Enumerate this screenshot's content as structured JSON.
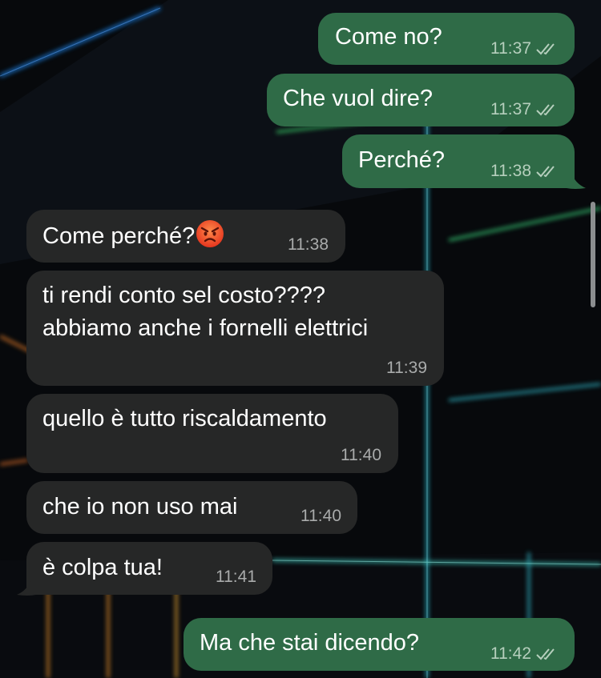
{
  "messages": [
    {
      "direction": "out",
      "text": "Come no?",
      "time": "11:37",
      "status_icon": "double-check-icon"
    },
    {
      "direction": "out",
      "text": "Che vuol dire?",
      "time": "11:37",
      "status_icon": "double-check-icon"
    },
    {
      "direction": "out",
      "text": "Perché?",
      "time": "11:38",
      "status_icon": "double-check-icon"
    },
    {
      "direction": "in",
      "text": "Come perché?",
      "emoji": "angry-face-emoji",
      "time": "11:38"
    },
    {
      "direction": "in",
      "lines": [
        "ti rendi conto sel costo????",
        "abbiamo anche i fornelli elettrici"
      ],
      "time": "11:39"
    },
    {
      "direction": "in",
      "text": "quello è tutto riscaldamento",
      "time": "11:40"
    },
    {
      "direction": "in",
      "text": "che io non uso mai",
      "time": "11:40"
    },
    {
      "direction": "in",
      "text": "è colpa tua!",
      "time": "11:41"
    },
    {
      "direction": "out",
      "text": "Ma che stai dicendo?",
      "time": "11:42",
      "status_icon": "double-check-icon"
    }
  ],
  "colors": {
    "outgoing_bubble": "#2f6b47",
    "incoming_bubble": "#262727",
    "text": "#ffffff",
    "outgoing_meta": "#b6cfbd",
    "incoming_meta": "#a9abab",
    "background": "#07090c"
  }
}
